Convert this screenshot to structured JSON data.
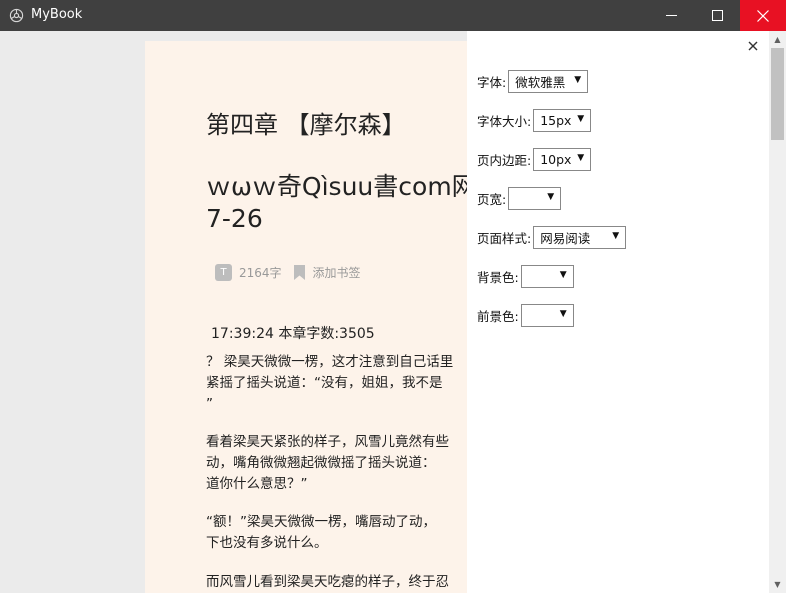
{
  "window": {
    "title": "MyBook",
    "minimize_glyph": "—",
    "maximize_glyph": "☐",
    "close_glyph": "✕",
    "close_color": "#e81123"
  },
  "reader": {
    "chapter_title": "第四章 【摩尔森】",
    "subtitle": "ｗωｗ奇Qìsuu書com网 7-26",
    "meta": {
      "badge": "T",
      "word_count": "2164字",
      "bookmark_label": "添加书签",
      "bookmark_icon": "bookmark-icon"
    },
    "timeline": "17:39:24 本章字数:3505",
    "paragraphs": [
      "？ 梁昊天微微一楞，这才注意到自己话里\n紧摇了摇头说道：“没有，姐姐，我不是\n”",
      "看着梁昊天紧张的样子，风雪儿竟然有些\n动，嘴角微微翘起微微摇了摇头说道：\n道你什么意思？”",
      "“额！”梁昊天微微一楞，嘴唇动了动，\n下也没有多说什么。",
      "而风雪儿看到梁昊天吃瘪的样子，终于忍"
    ],
    "background_color": "#fdf3ea"
  },
  "settings": {
    "close_glyph": "×",
    "font": {
      "label": "字体:",
      "value": "微软雅黑"
    },
    "font_size": {
      "label": "字体大小:",
      "value": "15px"
    },
    "page_padding": {
      "label": "页内边距:",
      "value": "10px"
    },
    "page_width": {
      "label": "页宽:",
      "value": ""
    },
    "page_style": {
      "label": "页面样式:",
      "value": "网易阅读"
    },
    "background_color": {
      "label": "背景色:",
      "value": ""
    },
    "foreground_color": {
      "label": "前景色:",
      "value": ""
    },
    "dropdown_arrow": "▼"
  },
  "scrollbar": {
    "up_glyph": "▲",
    "down_glyph": "▼"
  }
}
